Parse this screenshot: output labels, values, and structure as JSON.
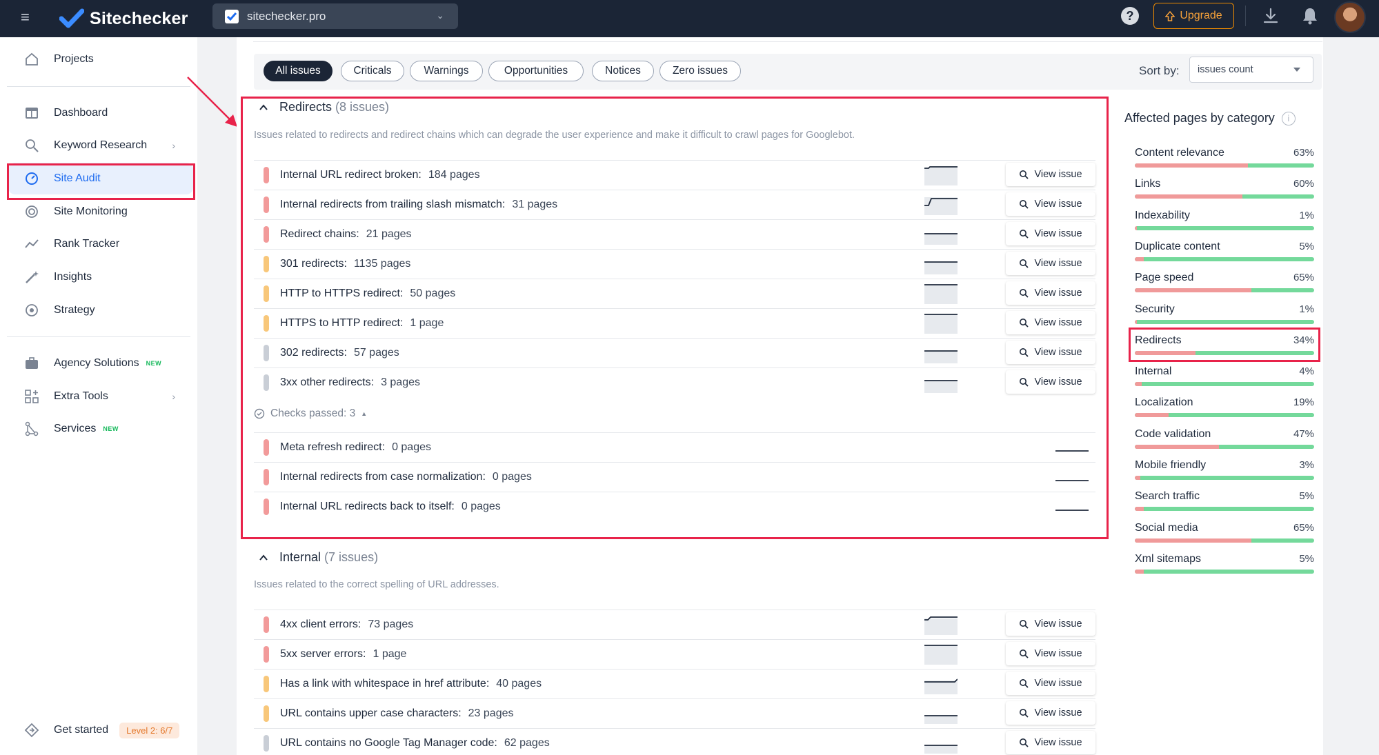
{
  "header": {
    "app_name": "Sitechecker",
    "site": "sitechecker.pro",
    "upgrade_label": "Upgrade",
    "help_label": "?"
  },
  "sidebar": {
    "items": [
      {
        "label": "Projects",
        "icon": "home-icon"
      },
      {
        "label": "Dashboard",
        "icon": "dashboard-icon"
      },
      {
        "label": "Keyword Research",
        "icon": "keyword-icon",
        "has_submenu": true
      },
      {
        "label": "Site Audit",
        "icon": "gauge-icon",
        "active": true
      },
      {
        "label": "Site Monitoring",
        "icon": "monitoring-icon"
      },
      {
        "label": "Rank Tracker",
        "icon": "trend-icon"
      },
      {
        "label": "Insights",
        "icon": "wand-icon"
      },
      {
        "label": "Strategy",
        "icon": "target-icon"
      },
      {
        "label": "Agency Solutions",
        "icon": "briefcase-icon",
        "badge": "NEW"
      },
      {
        "label": "Extra Tools",
        "icon": "grid-plus-icon",
        "has_submenu": true
      },
      {
        "label": "Services",
        "icon": "nodes-icon",
        "badge": "NEW"
      }
    ],
    "get_started": {
      "label": "Get started",
      "level": "Level 2: 6/7"
    }
  },
  "filters": {
    "tabs": [
      "All issues",
      "Criticals",
      "Warnings",
      "Opportunities",
      "Notices",
      "Zero issues"
    ],
    "active": "All issues",
    "sort_label": "Sort by:",
    "sort_value": "issues count"
  },
  "redirects": {
    "title": "Redirects",
    "count": "(8 issues)",
    "description": "Issues related to redirects and redirect chains which can degrade the user experience and make it difficult to crawl pages for Googlebot.",
    "issues": [
      {
        "title": "Internal URL redirect broken:",
        "pages": "184 pages",
        "severity": "red"
      },
      {
        "title": "Internal redirects from trailing slash mismatch:",
        "pages": "31 pages",
        "severity": "red"
      },
      {
        "title": "Redirect chains:",
        "pages": "21 pages",
        "severity": "red"
      },
      {
        "title": "301 redirects:",
        "pages": "1135 pages",
        "severity": "orange"
      },
      {
        "title": "HTTP to HTTPS redirect:",
        "pages": "50 pages",
        "severity": "orange"
      },
      {
        "title": "HTTPS to HTTP redirect:",
        "pages": "1 page",
        "severity": "orange"
      },
      {
        "title": "302 redirects:",
        "pages": "57 pages",
        "severity": "gray"
      },
      {
        "title": "3xx other redirects:",
        "pages": "3 pages",
        "severity": "gray"
      }
    ],
    "checks_passed": "Checks passed: 3",
    "passed": [
      {
        "title": "Meta refresh redirect:",
        "pages": "0 pages"
      },
      {
        "title": "Internal redirects from case normalization:",
        "pages": "0 pages"
      },
      {
        "title": "Internal URL redirects back to itself:",
        "pages": "0 pages"
      }
    ]
  },
  "internal": {
    "title": "Internal",
    "count": "(7 issues)",
    "description": "Issues related to the correct spelling of URL addresses.",
    "issues": [
      {
        "title": "4xx client errors:",
        "pages": "73 pages",
        "severity": "red"
      },
      {
        "title": "5xx server errors:",
        "pages": "1 page",
        "severity": "red"
      },
      {
        "title": "Has a link with whitespace in href attribute:",
        "pages": "40 pages",
        "severity": "orange"
      },
      {
        "title": "URL contains upper case characters:",
        "pages": "23 pages",
        "severity": "orange"
      },
      {
        "title": "URL contains no Google Tag Manager code:",
        "pages": "62 pages",
        "severity": "gray"
      }
    ]
  },
  "view_issue_label": "View issue",
  "categories": {
    "title": "Affected pages by category",
    "items": [
      {
        "name": "Content relevance",
        "pct": "63%",
        "value": 63
      },
      {
        "name": "Links",
        "pct": "60%",
        "value": 60
      },
      {
        "name": "Indexability",
        "pct": "1%",
        "value": 1
      },
      {
        "name": "Duplicate content",
        "pct": "5%",
        "value": 5
      },
      {
        "name": "Page speed",
        "pct": "65%",
        "value": 65
      },
      {
        "name": "Security",
        "pct": "1%",
        "value": 1
      },
      {
        "name": "Redirects",
        "pct": "34%",
        "value": 34
      },
      {
        "name": "Internal",
        "pct": "4%",
        "value": 4
      },
      {
        "name": "Localization",
        "pct": "19%",
        "value": 19
      },
      {
        "name": "Code validation",
        "pct": "47%",
        "value": 47
      },
      {
        "name": "Mobile friendly",
        "pct": "3%",
        "value": 3
      },
      {
        "name": "Search traffic",
        "pct": "5%",
        "value": 5
      },
      {
        "name": "Social media",
        "pct": "65%",
        "value": 65
      },
      {
        "name": "Xml sitemaps",
        "pct": "5%",
        "value": 5
      }
    ]
  },
  "colors": {
    "accent": "#1d6bf0",
    "highlight": "#e8234a",
    "bad": "#f09a9a",
    "good": "#74d99b"
  }
}
